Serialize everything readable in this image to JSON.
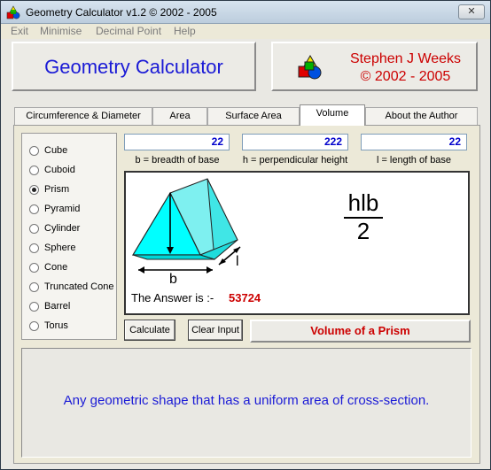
{
  "window": {
    "title": "Geometry Calculator v1.2 ©  2002 - 2005",
    "close_label": "✕"
  },
  "menu": [
    "Exit",
    "Minimise",
    "Decimal Point",
    "Help"
  ],
  "header": {
    "app_name": "Geometry Calculator",
    "author_name": "Stephen J Weeks",
    "author_years": "© 2002 - 2005"
  },
  "tabs": [
    {
      "label": "Circumference & Diameter",
      "active": false
    },
    {
      "label": "Area",
      "active": false
    },
    {
      "label": "Surface Area",
      "active": false
    },
    {
      "label": "Volume",
      "active": true
    },
    {
      "label": "About the Author",
      "active": false
    }
  ],
  "shapes": [
    {
      "label": "Cube",
      "checked": false
    },
    {
      "label": "Cuboid",
      "checked": false
    },
    {
      "label": "Prism",
      "checked": true
    },
    {
      "label": "Pyramid",
      "checked": false
    },
    {
      "label": "Cylinder",
      "checked": false
    },
    {
      "label": "Sphere",
      "checked": false
    },
    {
      "label": "Cone",
      "checked": false
    },
    {
      "label": "Truncated Cone",
      "checked": false
    },
    {
      "label": "Barrel",
      "checked": false
    },
    {
      "label": "Torus",
      "checked": false
    }
  ],
  "inputs": [
    {
      "value": "22",
      "label": "b = breadth of base"
    },
    {
      "value": "222",
      "label": "h = perpendicular height"
    },
    {
      "value": "22",
      "label": "l = length of base"
    }
  ],
  "diagram": {
    "label_b": "b",
    "label_l": "l",
    "label_h": ""
  },
  "formula": {
    "numerator": "hlb",
    "denominator": "2"
  },
  "answer": {
    "label": "The Answer is :-",
    "value": "53724"
  },
  "buttons": {
    "calculate": "Calculate",
    "clear_input": "Clear Input"
  },
  "result_title": "Volume of a Prism",
  "description": "Any geometric shape that has a uniform area of cross-section.",
  "colors": {
    "accent_blue": "#1a1ad6",
    "accent_red": "#cc0000",
    "prism_fill": "#00ffff"
  }
}
